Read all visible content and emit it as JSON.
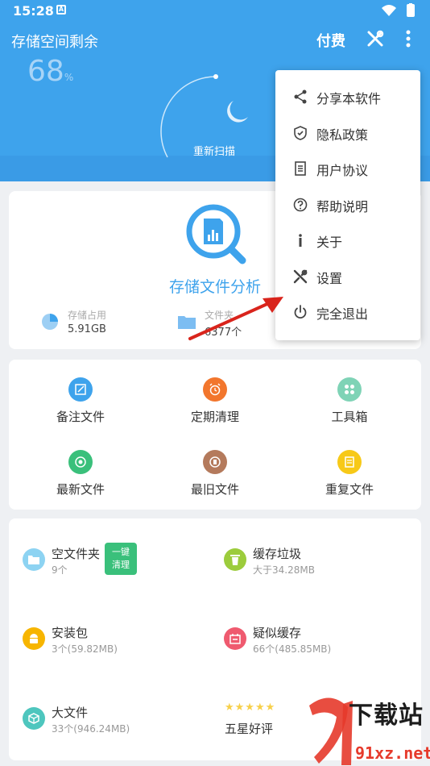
{
  "status": {
    "time": "15:28",
    "a_icon": "A"
  },
  "header": {
    "title": "存储空间剩余",
    "pay": "付费",
    "percent": "68",
    "percent_unit": "%",
    "rescan": "重新扫描"
  },
  "analysis": {
    "title": "存储文件分析",
    "stats": [
      {
        "label": "存储占用",
        "value": "5.91GB"
      },
      {
        "label": "文件夹",
        "value": "6377个"
      }
    ]
  },
  "tools": [
    {
      "label": "备注文件",
      "color": "#3ea3ec",
      "icon": "edit-icon"
    },
    {
      "label": "定期清理",
      "color": "#f2762d",
      "icon": "alarm-icon"
    },
    {
      "label": "工具箱",
      "color": "#7fd3b6",
      "icon": "toolbox-icon"
    },
    {
      "label": "最新文件",
      "color": "#3ac07b",
      "icon": "new-file-icon"
    },
    {
      "label": "最旧文件",
      "color": "#b47a5c",
      "icon": "old-file-icon"
    },
    {
      "label": "重复文件",
      "color": "#f7c918",
      "icon": "duplicate-icon"
    }
  ],
  "cleanup": [
    {
      "title": "空文件夹",
      "sub": "9个",
      "color": "#8dd3f2",
      "icon": "folder-icon"
    },
    {
      "title": "缓存垃圾",
      "sub": "大于34.28MB",
      "color": "#9ccc3c",
      "icon": "trash-icon"
    },
    {
      "title": "安装包",
      "sub": "3个(59.82MB)",
      "color": "#f7b500",
      "icon": "android-icon"
    },
    {
      "title": "疑似缓存",
      "sub": "66个(485.85MB)",
      "color": "#ef5a6f",
      "icon": "cache-icon"
    },
    {
      "title": "大文件",
      "sub": "33个(946.24MB)",
      "color": "#4ec6be",
      "icon": "box-icon"
    }
  ],
  "onekey": {
    "line1": "一键",
    "line2": "清理"
  },
  "rating": {
    "stars": "★★★★★",
    "label": "五星好评"
  },
  "menu": [
    {
      "label": "分享本软件",
      "icon": "share-icon"
    },
    {
      "label": "隐私政策",
      "icon": "shield-icon"
    },
    {
      "label": "用户协议",
      "icon": "document-icon"
    },
    {
      "label": "帮助说明",
      "icon": "help-icon"
    },
    {
      "label": "关于",
      "icon": "info-icon"
    },
    {
      "label": "设置",
      "icon": "tools-icon"
    },
    {
      "label": "完全退出",
      "icon": "power-icon"
    }
  ],
  "watermark": {
    "text": "下载站",
    "domain": "91xz.net"
  }
}
